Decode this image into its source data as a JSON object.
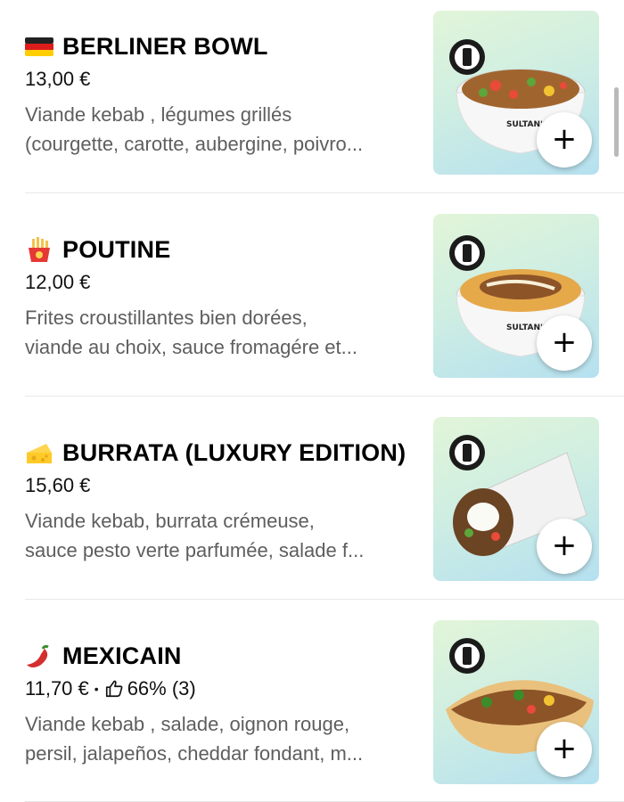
{
  "menu": {
    "items": [
      {
        "flag_icon": "germany-flag-icon",
        "title": "BERLINER BOWL",
        "price": "13,00 €",
        "desc_line1": "Viande kebab , légumes grillés",
        "desc_line2": "(courgette, carotte, aubergine, poivro...",
        "image": "berliner-bowl-image",
        "add_label": "+"
      },
      {
        "flag_icon": "fries-icon",
        "title": "POUTINE",
        "price": "12,00 €",
        "desc_line1": "Frites croustillantes bien dorées,",
        "desc_line2": "viande au choix, sauce fromagére et...",
        "image": "poutine-image",
        "add_label": "+"
      },
      {
        "flag_icon": "cheese-icon",
        "title": "BURRATA (LUXURY EDITION)",
        "price": "15,60 €",
        "desc_line1": "Viande kebab, burrata crémeuse,",
        "desc_line2": "sauce pesto verte parfumée, salade f...",
        "image": "burrata-wrap-image",
        "add_label": "+"
      },
      {
        "flag_icon": "chili-pepper-icon",
        "title": "MEXICAIN",
        "price": "11,70 €",
        "separator": "•",
        "rating_icon": "thumbs-up-icon",
        "rating": "66% (3)",
        "desc_line1": "Viande kebab , salade, oignon rouge,",
        "desc_line2": "persil, jalapeños, cheddar fondant, m...",
        "image": "mexicain-sandwich-image",
        "add_label": "+"
      }
    ]
  },
  "colors": {
    "text_primary": "#000000",
    "text_secondary": "#5e5e5e",
    "divider": "#e8e8e8",
    "image_bg_top": "#e2f5d8",
    "image_bg_bottom": "#b5e0f0"
  }
}
